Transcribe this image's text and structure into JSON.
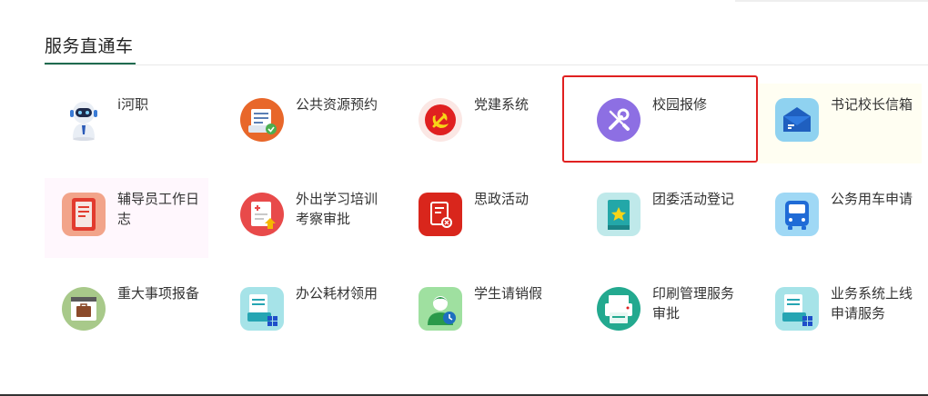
{
  "section": {
    "title": "服务直通车"
  },
  "tiles": [
    {
      "label": "i河职",
      "icon": "robot-icon"
    },
    {
      "label": "公共资源预约",
      "icon": "resource-booking-icon"
    },
    {
      "label": "党建系统",
      "icon": "party-emblem-icon"
    },
    {
      "label": "校园报修",
      "icon": "wrench-icon"
    },
    {
      "label": "书记校长信箱",
      "icon": "mailbox-icon"
    },
    {
      "label": "辅导员工作日志",
      "icon": "notebook-icon"
    },
    {
      "label": "外出学习培训考察审批",
      "icon": "travel-doc-icon"
    },
    {
      "label": "思政活动",
      "icon": "activity-doc-icon"
    },
    {
      "label": "团委活动登记",
      "icon": "star-book-icon"
    },
    {
      "label": "公务用车申请",
      "icon": "bus-icon"
    },
    {
      "label": "重大事项报备",
      "icon": "briefcase-icon"
    },
    {
      "label": "办公耗材领用",
      "icon": "office-supplies-icon"
    },
    {
      "label": "学生请销假",
      "icon": "student-leave-icon"
    },
    {
      "label": "印刷管理服务审批",
      "icon": "printer-icon"
    },
    {
      "label": "业务系统上线申请服务",
      "icon": "system-launch-icon"
    }
  ],
  "colors": {
    "accent": "#1f6b4f",
    "highlight": "#e02020"
  }
}
